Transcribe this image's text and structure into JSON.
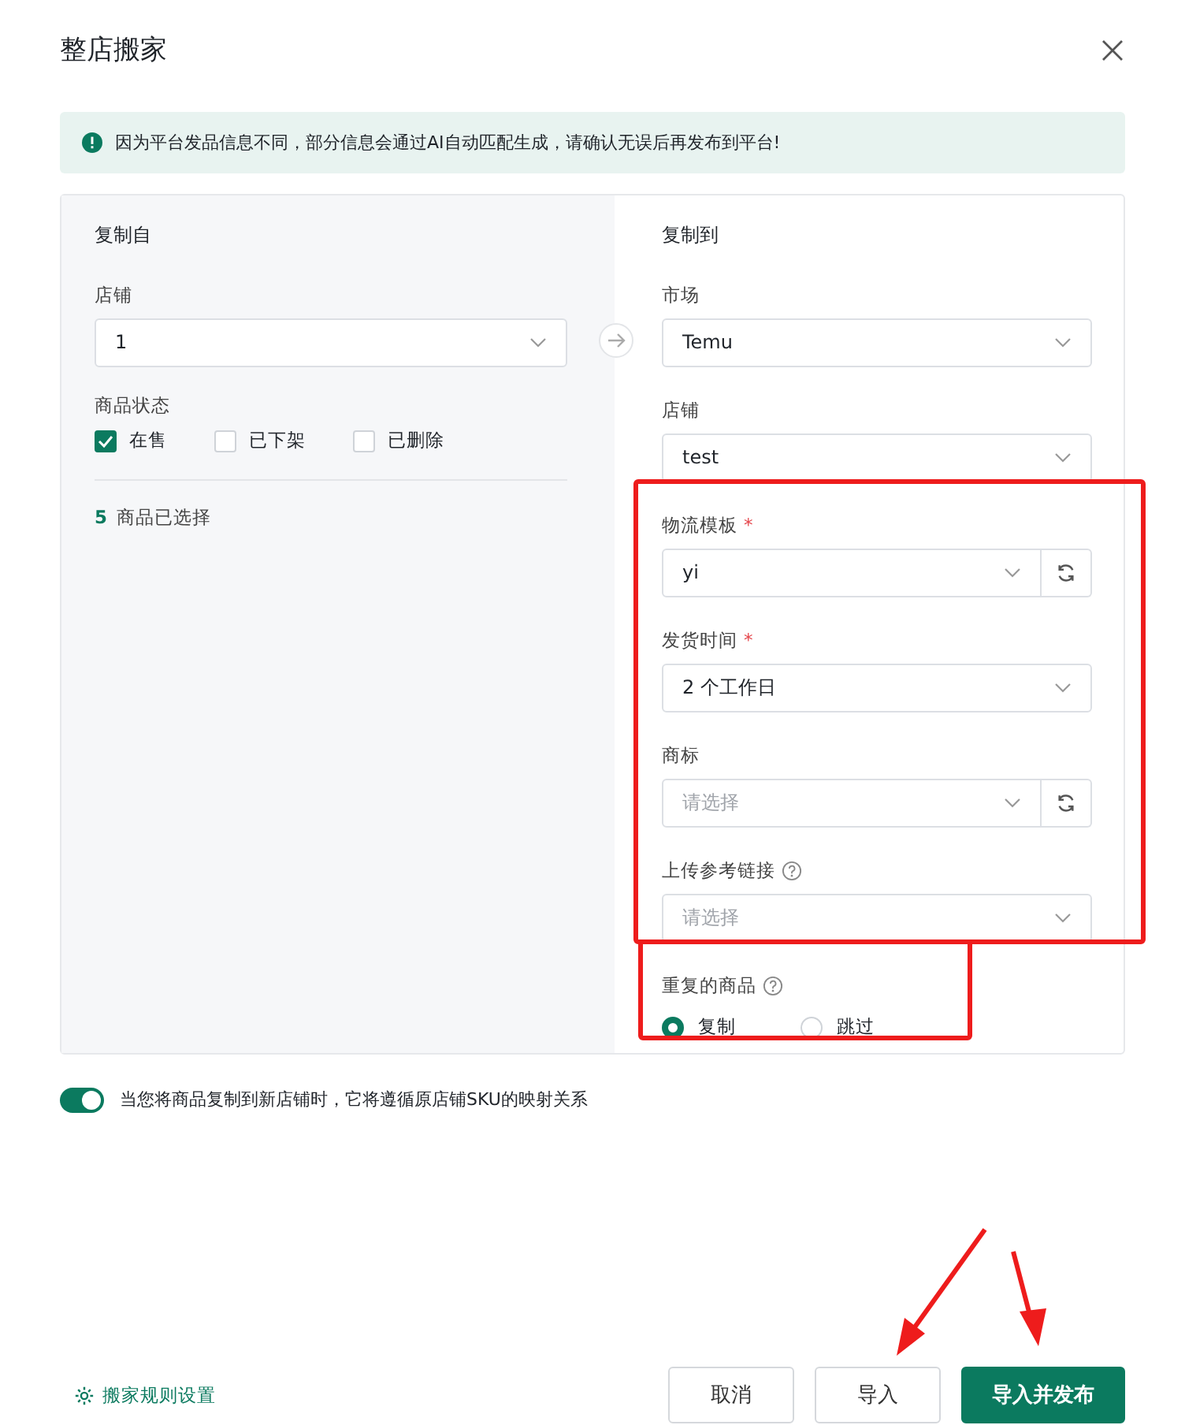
{
  "dialog": {
    "title": "整店搬家"
  },
  "alert": {
    "text": "因为平台发品信息不同，部分信息会通过AI自动匹配生成，请确认无误后再发布到平台!"
  },
  "source": {
    "heading": "复制自",
    "store_label": "店铺",
    "store_value": "1",
    "status_label": "商品状态",
    "statuses": [
      {
        "label": "在售",
        "checked": true
      },
      {
        "label": "已下架",
        "checked": false
      },
      {
        "label": "已删除",
        "checked": false
      }
    ],
    "selected_count": "5",
    "selected_text": "商品已选择"
  },
  "target": {
    "heading": "复制到",
    "fields": [
      {
        "kind": "select",
        "label": "市场",
        "help": false,
        "value": "Temu"
      },
      {
        "kind": "select",
        "label": "店铺",
        "help": false,
        "value": "test"
      },
      {
        "kind": "select_refresh",
        "label": "物流模板",
        "required_mark": "*",
        "help": false,
        "value": "yi"
      },
      {
        "kind": "select",
        "label": "发货时间",
        "required_mark": "*",
        "help": false,
        "value": "2 个工作日"
      },
      {
        "kind": "select_refresh",
        "label": "商标",
        "help": false,
        "placeholder": "请选择"
      },
      {
        "kind": "select",
        "label": "上传参考链接",
        "help": true,
        "placeholder": "请选择"
      }
    ],
    "duplicate_label": "重复的商品",
    "duplicate_options": [
      {
        "label": "复制",
        "selected": true
      },
      {
        "label": "跳过",
        "selected": false
      }
    ]
  },
  "mapping_toggle": {
    "on": true,
    "text": "当您将商品复制到新店铺时，它将遵循原店铺SKU的映射关系"
  },
  "footer": {
    "rules_link": "搬家规则设置",
    "buttons": [
      {
        "label": "取消",
        "kind": "secondary"
      },
      {
        "label": "导入",
        "kind": "secondary"
      },
      {
        "label": "导入并发布",
        "kind": "primary"
      }
    ]
  }
}
